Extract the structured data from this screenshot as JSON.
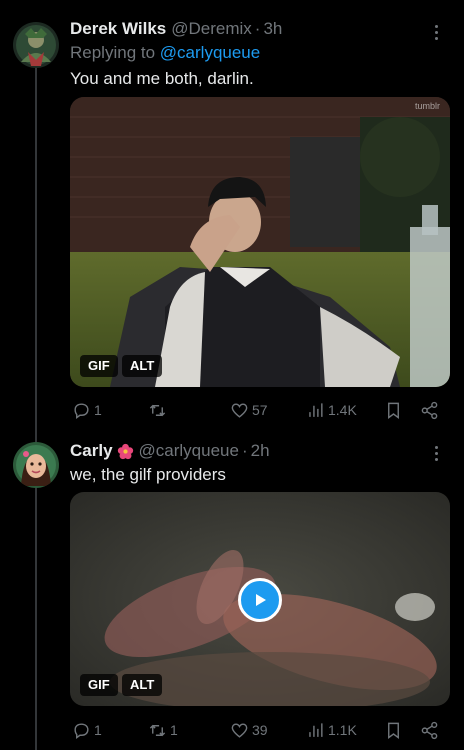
{
  "tweets": [
    {
      "name": "Derek Wilks",
      "handle": "@Deremix",
      "time": "3h",
      "replying_prefix": "Replying to",
      "replying_to": "@carlyqueue",
      "text": "You and me both, darlin.",
      "media": {
        "gif_label": "GIF",
        "alt_label": "ALT",
        "watermark": "tumblr"
      },
      "stats": {
        "replies": "1",
        "retweets": "",
        "likes": "57",
        "views": "1.4K"
      }
    },
    {
      "name": "Carly",
      "handle": "@carlyqueue",
      "time": "2h",
      "text": "we, the gilf providers",
      "media": {
        "gif_label": "GIF",
        "alt_label": "ALT"
      },
      "stats": {
        "replies": "1",
        "retweets": "1",
        "likes": "39",
        "views": "1.1K"
      }
    }
  ],
  "separator": "·",
  "colors": {
    "background": "#000000",
    "text": "#e7e9ea",
    "muted": "#71767b",
    "link": "#1d9bf0",
    "line": "#333639"
  }
}
